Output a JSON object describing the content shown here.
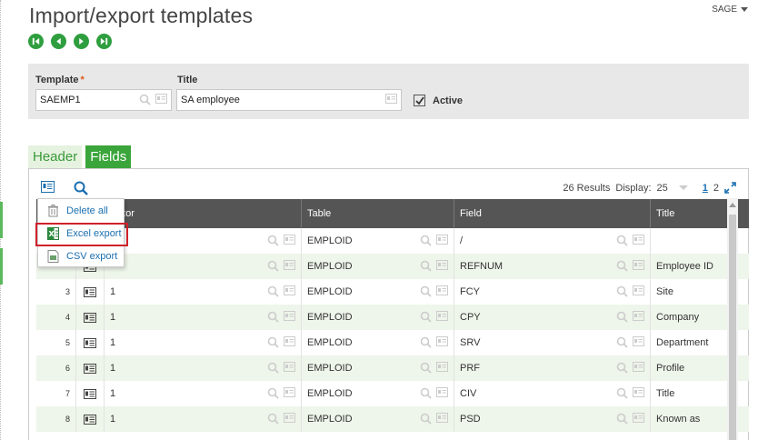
{
  "page": {
    "title": "Import/export templates",
    "user": "SAGE"
  },
  "nav": [
    "first-record",
    "previous-record",
    "next-record",
    "last-record"
  ],
  "form": {
    "template_label": "Template",
    "template_required": "*",
    "template_value": "SAEMP1",
    "title_label": "Title",
    "title_value": "SA employee",
    "active_label": "Active",
    "active_checked": true
  },
  "tabs": [
    {
      "label": "Header",
      "active": false
    },
    {
      "label": "Fields",
      "active": true
    }
  ],
  "grid": {
    "results": "26 Results",
    "display_label": "Display:",
    "display_value": "25",
    "pages": [
      "1",
      "2"
    ],
    "current_page": "1",
    "columns": [
      "Indicator",
      "Table",
      "Field",
      "Title"
    ],
    "visible_indicator_header": "icator",
    "rows": [
      {
        "num": "",
        "indicator": "",
        "table": "EMPLOID",
        "field": "/",
        "title": ""
      },
      {
        "num": "",
        "indicator": "",
        "table": "EMPLOID",
        "field": "REFNUM",
        "title": "Employee ID"
      },
      {
        "num": "3",
        "indicator": "1",
        "table": "EMPLOID",
        "field": "FCY",
        "title": "Site"
      },
      {
        "num": "4",
        "indicator": "1",
        "table": "EMPLOID",
        "field": "CPY",
        "title": "Company"
      },
      {
        "num": "5",
        "indicator": "1",
        "table": "EMPLOID",
        "field": "SRV",
        "title": "Department"
      },
      {
        "num": "6",
        "indicator": "1",
        "table": "EMPLOID",
        "field": "PRF",
        "title": "Profile"
      },
      {
        "num": "7",
        "indicator": "1",
        "table": "EMPLOID",
        "field": "CIV",
        "title": "Title"
      },
      {
        "num": "8",
        "indicator": "1",
        "table": "EMPLOID",
        "field": "PSD",
        "title": "Known as"
      }
    ]
  },
  "menu": {
    "items": [
      {
        "label": "Delete all",
        "icon": "trash-icon"
      },
      {
        "label": "Excel export",
        "icon": "excel-icon"
      },
      {
        "label": "CSV export",
        "icon": "csv-file-icon"
      }
    ],
    "highlighted": "Excel export"
  },
  "colors": {
    "accent_green": "#3aa53a",
    "nav_green": "#2e9e3e",
    "header_dark": "#555555",
    "highlight_red": "#d0202a",
    "link_blue": "#1a6fb0"
  }
}
